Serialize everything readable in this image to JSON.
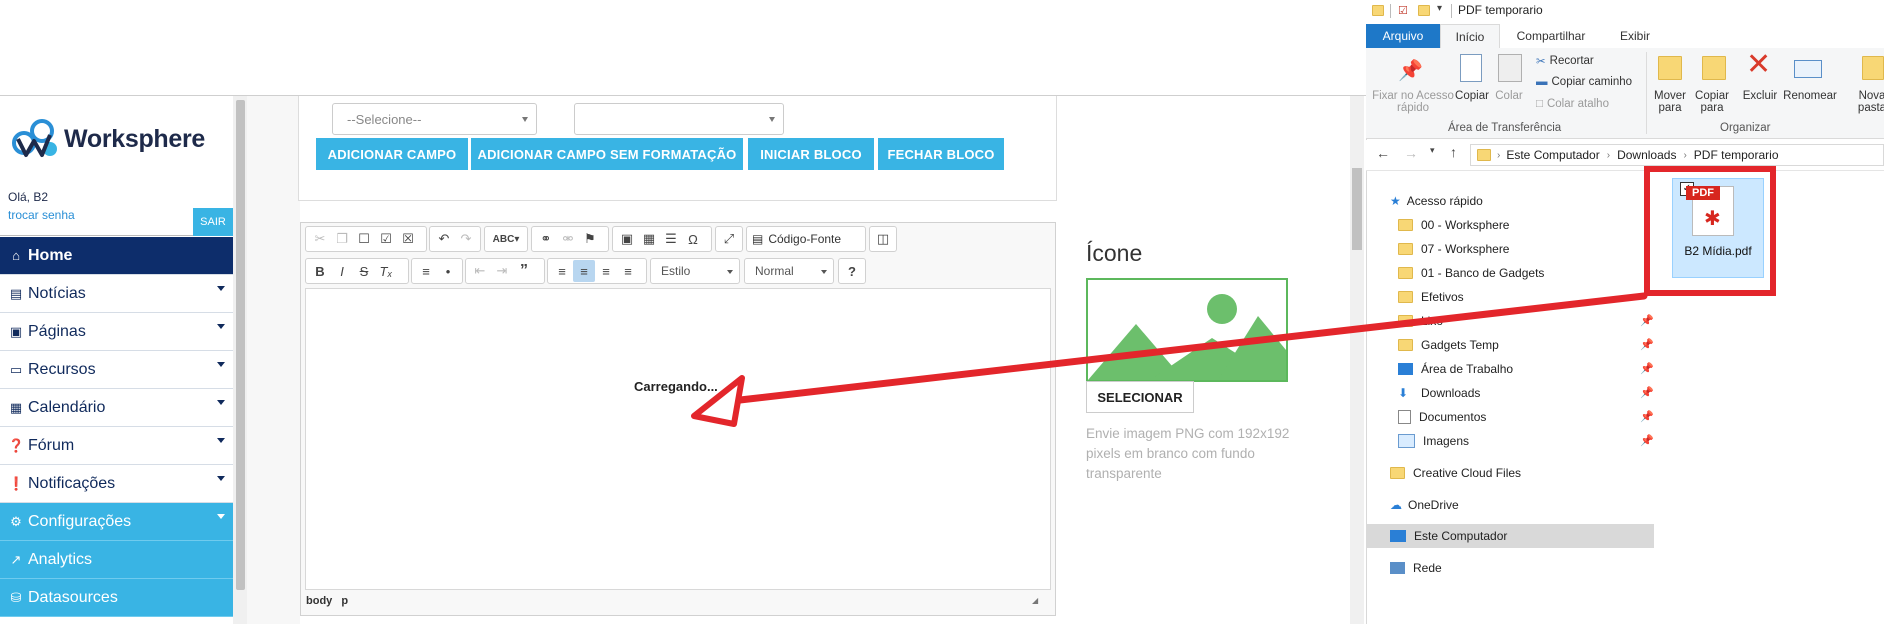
{
  "colors": {
    "brand_navy": "#0d2d6b",
    "brand_blue": "#39b4e4",
    "annotation_red": "#e3262b",
    "explorer_blue": "#1e78c8"
  },
  "app": {
    "logo_text": "Worksphere",
    "greeting": "Olá, B2",
    "change_password": "trocar senha",
    "logout": "SAIR",
    "menu": [
      {
        "label": "Home",
        "icon": "home-icon",
        "state": "active"
      },
      {
        "label": "Notícias",
        "icon": "newspaper-icon",
        "state": "normal"
      },
      {
        "label": "Páginas",
        "icon": "window-icon",
        "state": "normal"
      },
      {
        "label": "Recursos",
        "icon": "laptop-icon",
        "state": "normal"
      },
      {
        "label": "Calendário",
        "icon": "calendar-icon",
        "state": "normal"
      },
      {
        "label": "Fórum",
        "icon": "question-circle-icon",
        "state": "normal"
      },
      {
        "label": "Notificações",
        "icon": "exclamation-circle-icon",
        "state": "normal"
      },
      {
        "label": "Configurações",
        "icon": "gear-icon",
        "state": "highlight"
      },
      {
        "label": "Analytics",
        "icon": "chart-line-icon",
        "state": "highlight"
      },
      {
        "label": "Datasources",
        "icon": "database-icon",
        "state": "highlight"
      }
    ]
  },
  "form": {
    "select1_value": "--Selecione--",
    "select2_value": "",
    "buttons": [
      "ADICIONAR CAMPO",
      "ADICIONAR CAMPO SEM FORMATAÇÃO",
      "INICIAR BLOCO",
      "FECHAR BLOCO"
    ]
  },
  "editor": {
    "source_label": "Código-Fonte",
    "style_combo": "Estilo",
    "format_combo": "Normal",
    "loading_text": "Carregando...",
    "status_path": [
      "body",
      "p"
    ]
  },
  "icon_panel": {
    "title": "Ícone",
    "select_button": "SELECIONAR",
    "help_text": "Envie imagem PNG com 192x192 pixels em branco com fundo transparente"
  },
  "explorer": {
    "window_title": "PDF temporario",
    "tabs": [
      "Arquivo",
      "Início",
      "Compartilhar",
      "Exibir"
    ],
    "active_tab": "Início",
    "ribbon": {
      "pin": "Fixar no Acesso rápido",
      "copy": "Copiar",
      "paste": "Colar",
      "cut": "Recortar",
      "copy_path": "Copiar caminho",
      "paste_shortcut": "Colar atalho",
      "clipboard_group": "Área de Transferência",
      "move_to": "Mover para",
      "copy_to": "Copiar para",
      "delete": "Excluir",
      "rename": "Renomear",
      "new_folder": "Nova pasta",
      "organize_group": "Organizar"
    },
    "breadcrumb": [
      "Este Computador",
      "Downloads",
      "PDF temporario"
    ],
    "nav": {
      "quick_access": "Acesso rápido",
      "items": [
        "00 - Worksphere",
        "07 - Worksphere",
        "01 - Banco de Gadgets",
        "Efetivos",
        "Lixo",
        "Gadgets Temp",
        "Área de Trabalho",
        "Downloads",
        "Documentos",
        "Imagens"
      ],
      "creative_cloud": "Creative Cloud Files",
      "onedrive": "OneDrive",
      "this_pc": "Este Computador",
      "network": "Rede"
    },
    "file": {
      "name": "B2 Mídia.pdf",
      "badge": "PDF"
    }
  }
}
